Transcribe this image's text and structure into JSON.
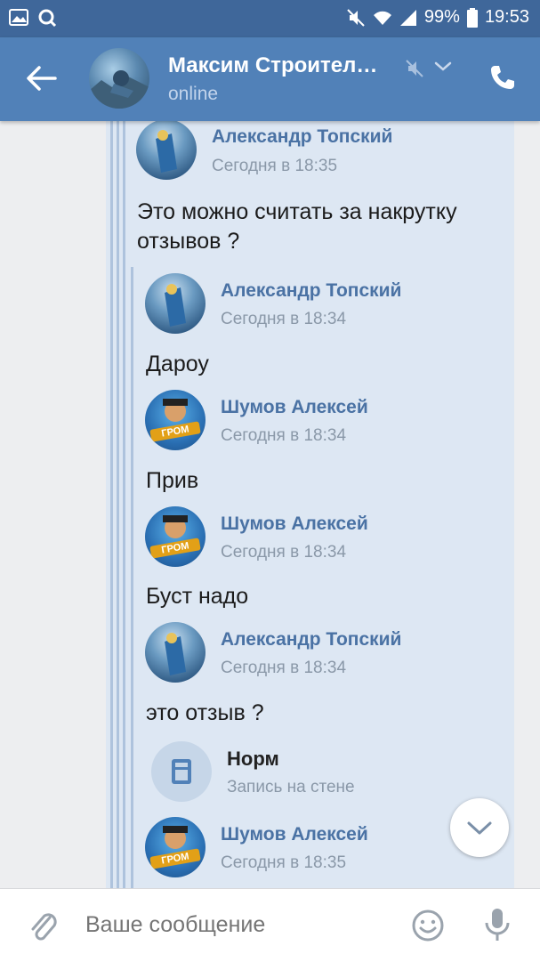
{
  "status_bar": {
    "battery": "99%",
    "time": "19:53"
  },
  "header": {
    "title": "Максим Строител…",
    "subtitle": "online"
  },
  "messages": {
    "m1": {
      "author": "Александр Топский",
      "time": "Сегодня в 18:35",
      "text_line1": "Это можно считать за накрутку",
      "text_line2": "отзывов ?"
    },
    "q1": {
      "author": "Александр Топский",
      "time": "Сегодня в 18:34",
      "text": "Дароу"
    },
    "q2": {
      "author": "Шумов Алексей",
      "time": "Сегодня в 18:34",
      "text": "Прив"
    },
    "q3": {
      "author": "Шумов Алексей",
      "time": "Сегодня в 18:34",
      "text": "Буст надо"
    },
    "q4": {
      "author": "Александр Топский",
      "time": "Сегодня в 18:34",
      "text": "это отзыв ?"
    },
    "wall": {
      "title": "Норм",
      "subtitle": "Запись на стене"
    },
    "q5": {
      "author": "Шумов Алексей",
      "time": "Сегодня в 18:35"
    }
  },
  "composer": {
    "placeholder": "Ваше сообщение"
  },
  "avatars": {
    "shumov_badge": "ГРОМ"
  },
  "colors": {
    "header": "#5181b8",
    "statusbar": "#3f679a",
    "bubble": "#dde7f3",
    "name": "#4a72a4"
  },
  "icons": [
    "image-icon",
    "search-icon",
    "mute-icon",
    "wifi-icon",
    "signal-icon",
    "battery-icon",
    "back-arrow-icon",
    "chevron-down-icon",
    "phone-icon",
    "document-icon",
    "scroll-down-icon",
    "attach-icon",
    "emoji-icon",
    "microphone-icon"
  ]
}
